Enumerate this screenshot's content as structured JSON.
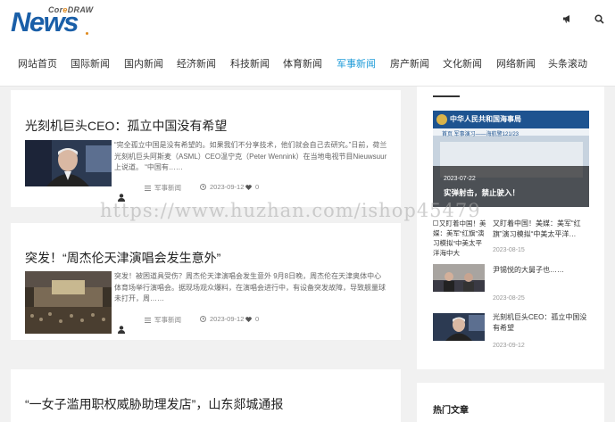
{
  "logo": {
    "main": "News",
    "sub_pre": "Cor",
    "sub_o": "e",
    "sub_post": "DRAW"
  },
  "icons": {
    "megaphone": "megaphone-icon",
    "search": "search-icon"
  },
  "nav": [
    {
      "label": "网站首页"
    },
    {
      "label": "国际新闻"
    },
    {
      "label": "国内新闻"
    },
    {
      "label": "经济新闻"
    },
    {
      "label": "科技新闻"
    },
    {
      "label": "体育新闻"
    },
    {
      "label": "军事新闻"
    },
    {
      "label": "房产新闻"
    },
    {
      "label": "文化新闻"
    },
    {
      "label": "网络新闻"
    },
    {
      "label": "头条滚动"
    }
  ],
  "active_color": "#1e9bd8",
  "articles": [
    {
      "title": "光刻机巨头CEO：孤立中国没有希望",
      "excerpt": "“完全孤立中国是没有希望的。如果我们不分享技术，他们就会自己去研究。”日前，荷兰光刻机巨头阿斯麦（ASML）CEO温宁克（Peter Wennink）在当地电视节目Nieuwsuur上说道。 “中国有……",
      "category": "军事新闻",
      "date": "2023-09-12",
      "likes": "0"
    },
    {
      "title": "突发！“周杰伦天津演唱会发生意外”",
      "excerpt": "突发！被困道具受伤？周杰伦天津演唱会发生意外 9月8日晚，周杰伦在天津奥体中心体育场举行演唱会。据现场观众爆料，在演唱会进行中，有设备突发故障，导致舰量球未打开，周……",
      "category": "军事新闻",
      "date": "2023-09-12",
      "likes": "0"
    },
    {
      "title": "“一女子滥用职权威胁助理发店”，山东郯城通报"
    }
  ],
  "sidebar": {
    "banner": {
      "header_text": "中华人民共和国海事局",
      "sub_text": "首页  军事演习——海航警121/23",
      "date": "2023-07-22",
      "title": "实弹射击，禁止驶入！"
    },
    "items": [
      {
        "broken_img_text": "又盯着中国！美媒：美军“红旗”演习模拟“中美太平洋海中大",
        "title": "又盯着中国！美媒：美军“红旗”演习模拟“中美太平洋…",
        "date": "2023-08-15"
      },
      {
        "title": "尹锡悦的大舅子也……",
        "date": "2023-08-25"
      },
      {
        "title": "光刻机巨头CEO：孤立中国没有希望",
        "date": "2023-09-12"
      }
    ],
    "hot_title": "热门文章"
  },
  "watermark": "https://www.huzhan.com/ishop45479"
}
